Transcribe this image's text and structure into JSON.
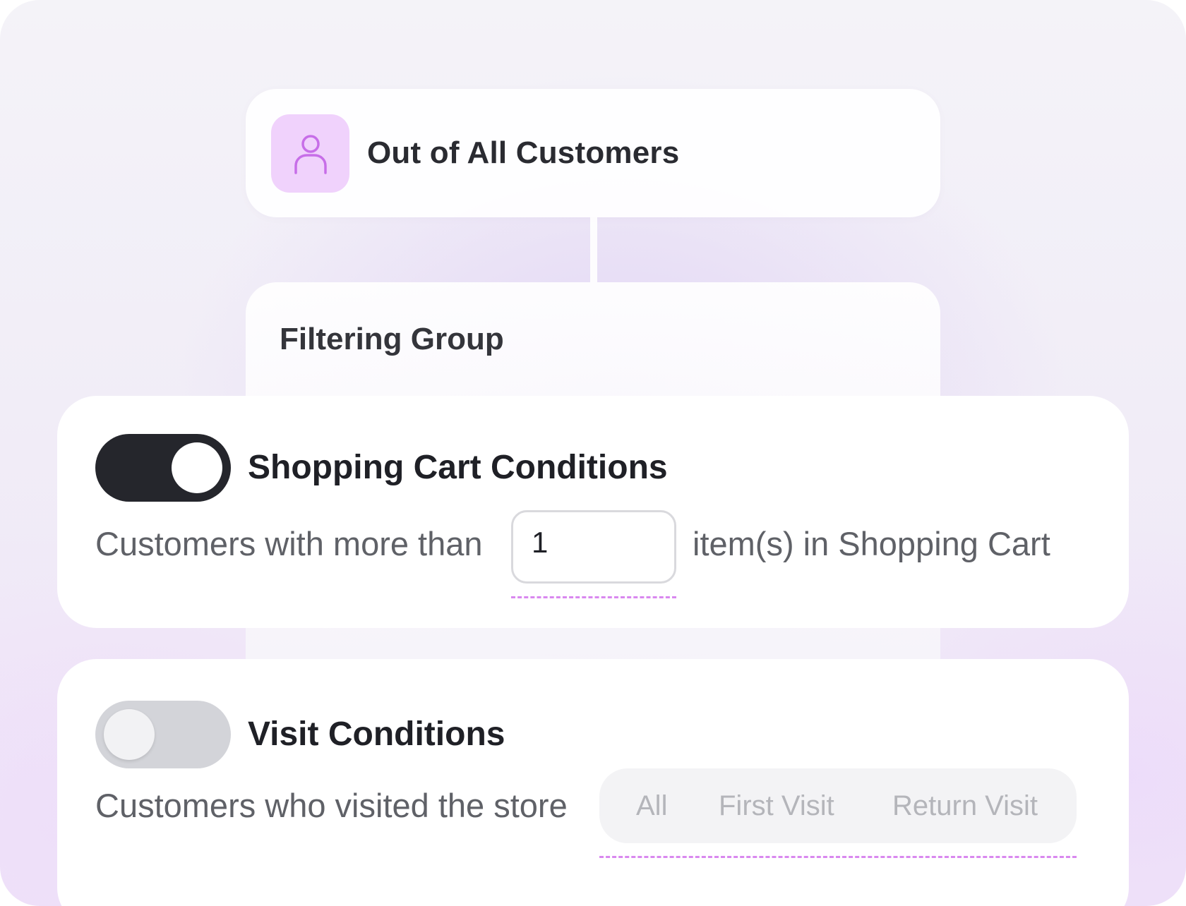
{
  "source": {
    "title": "Out of All Customers",
    "icon": "user-icon",
    "icon_bg_color": "#f0d2fc",
    "icon_color": "#c76ee8"
  },
  "group": {
    "title": "Filtering Group"
  },
  "cart_condition": {
    "title": "Shopping Cart Conditions",
    "enabled": true,
    "prefix_text": "Customers with more than",
    "quantity_value": "1",
    "suffix_text": "item(s) in Shopping Cart"
  },
  "visit_condition": {
    "title": "Visit Conditions",
    "enabled": false,
    "prefix_text": "Customers who visited the store",
    "options": [
      "All",
      "First Visit",
      "Return Visit"
    ]
  },
  "colors": {
    "toggle_on": "#25262c",
    "toggle_off": "#d3d4d9",
    "dash_accent": "#d988ef"
  }
}
